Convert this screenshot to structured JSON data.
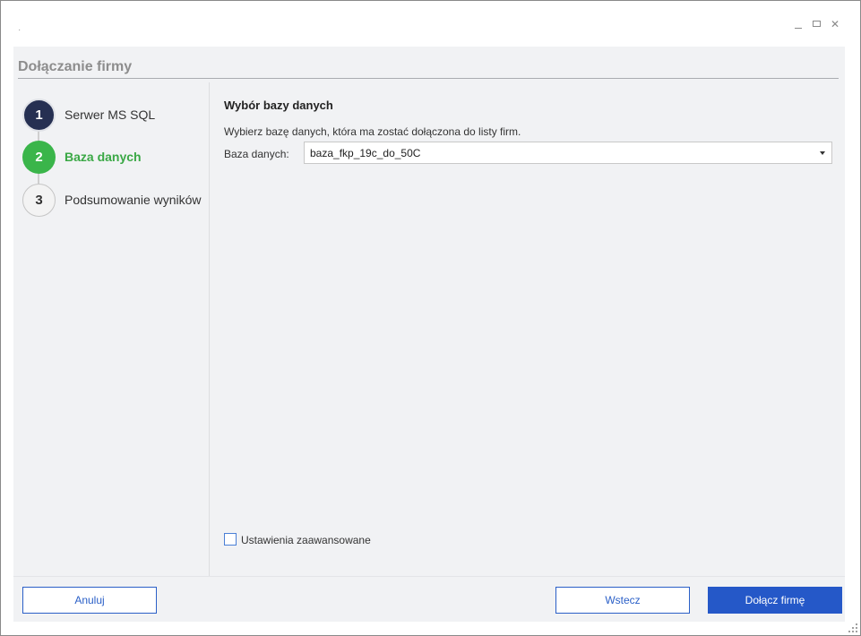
{
  "window": {
    "title": "·",
    "controls": {
      "minimize": "minimize-icon",
      "maximize": "maximize-icon",
      "close": "close-icon"
    }
  },
  "header": {
    "title": "Dołączanie firmy"
  },
  "steps": [
    {
      "number": "1",
      "label": "Serwer MS SQL",
      "state": "done"
    },
    {
      "number": "2",
      "label": "Baza danych",
      "state": "active"
    },
    {
      "number": "3",
      "label": "Podsumowanie wyników",
      "state": "todo"
    }
  ],
  "content": {
    "title": "Wybór bazy danych",
    "description": "Wybierz bazę danych, która ma zostać dołączona do listy firm.",
    "database_label": "Baza danych:",
    "database_value": "baza_fkp_19c_do_50C"
  },
  "advanced": {
    "label": "Ustawienia zaawansowane",
    "checked": false
  },
  "buttons": {
    "cancel": "Anuluj",
    "back": "Wstecz",
    "join": "Dołącz firmę"
  },
  "colors": {
    "accent": "#2558c8",
    "step_done": "#263052",
    "step_active": "#3ab54a",
    "panel_bg": "#f1f2f4"
  }
}
